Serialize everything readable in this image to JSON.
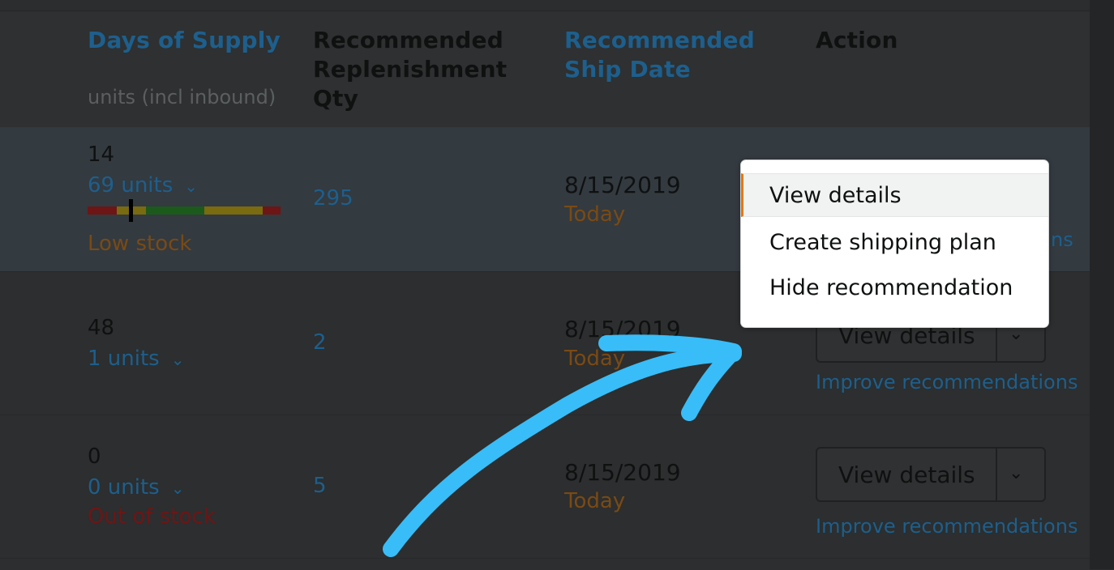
{
  "header": {
    "days_of_supply": "Days of Supply",
    "days_sub": "units (incl inbound)",
    "recommended_qty": [
      "Recommended",
      "Replenishment",
      "Qty"
    ],
    "recommended_date": [
      "Recommended",
      "Ship Date"
    ],
    "action": "Action"
  },
  "rows": [
    {
      "days": "14",
      "units": "69 units",
      "status": "Low stock",
      "qty": "295",
      "date": "8/15/2019",
      "date_note": "Today",
      "improve": "ns"
    },
    {
      "days": "48",
      "units": "1 units",
      "status": "",
      "qty": "2",
      "date": "8/15/2019",
      "date_note": "Today",
      "button": "View details",
      "improve": "Improve recommendations"
    },
    {
      "days": "0",
      "units": "0 units",
      "status": "Out of stock",
      "qty": "5",
      "date": "8/15/2019",
      "date_note": "Today",
      "button": "View details",
      "improve": "Improve recommendations"
    }
  ],
  "menu": {
    "items": [
      "View details",
      "Create shipping plan",
      "Hide recommendation"
    ]
  },
  "icons": {
    "chevron": "chevron-down-icon"
  },
  "colors": {
    "stock_bar": [
      "#6e1515",
      "#7a6a10",
      "#1b5a1b",
      "#7a6a10",
      "#6e1515"
    ],
    "annotation_arrow": "#38bdf8"
  }
}
